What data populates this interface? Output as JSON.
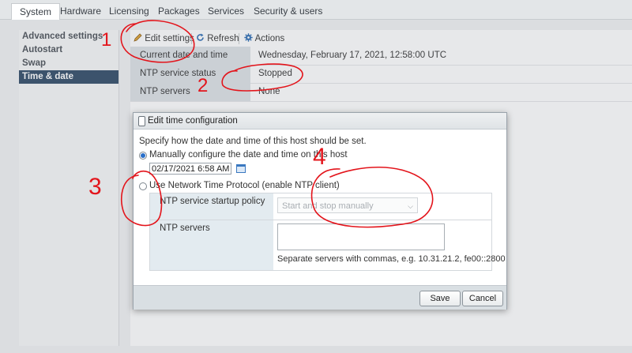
{
  "tabs": [
    "System",
    "Hardware",
    "Licensing",
    "Packages",
    "Services",
    "Security & users"
  ],
  "sidebar": {
    "items": [
      "Advanced settings",
      "Autostart",
      "Swap",
      "Time & date"
    ],
    "active_index": 3
  },
  "toolbar": {
    "edit_label": "Edit settings",
    "refresh_label": "Refresh",
    "actions_label": "Actions"
  },
  "info": {
    "rows": [
      {
        "key": "Current date and time",
        "value": "Wednesday, February 17, 2021, 12:58:00 UTC"
      },
      {
        "key": "NTP service status",
        "value": "Stopped"
      },
      {
        "key": "NTP servers",
        "value": "None"
      }
    ]
  },
  "dialog": {
    "title": "Edit time configuration",
    "instruction": "Specify how the date and time of this host should be set.",
    "manual_label": "Manually configure the date and time on this host",
    "date_value": "02/17/2021 6:58 AM",
    "ntp_label": "Use Network Time Protocol (enable NTP client)",
    "startup_policy_label": "NTP service startup policy",
    "startup_policy_value": "Start and stop manually",
    "ntp_servers_label": "NTP servers",
    "ntp_servers_value": "",
    "ntp_hint": "Separate servers with commas, e.g. 10.31.21.2, fe00::2800",
    "save_label": "Save",
    "cancel_label": "Cancel",
    "selected_option": "manual"
  },
  "annotations": {
    "numbers": [
      "1",
      "2",
      "3",
      "4"
    ],
    "color": "#e3141b"
  },
  "colors": {
    "sidebar_active": "#2f4a66",
    "radio_selected": "#2a6fc9",
    "annotation": "#e3141b"
  },
  "icons": [
    "pencil-icon",
    "refresh-icon",
    "gear-icon",
    "calendar-icon",
    "dialog-icon",
    "chevron-down-icon"
  ]
}
